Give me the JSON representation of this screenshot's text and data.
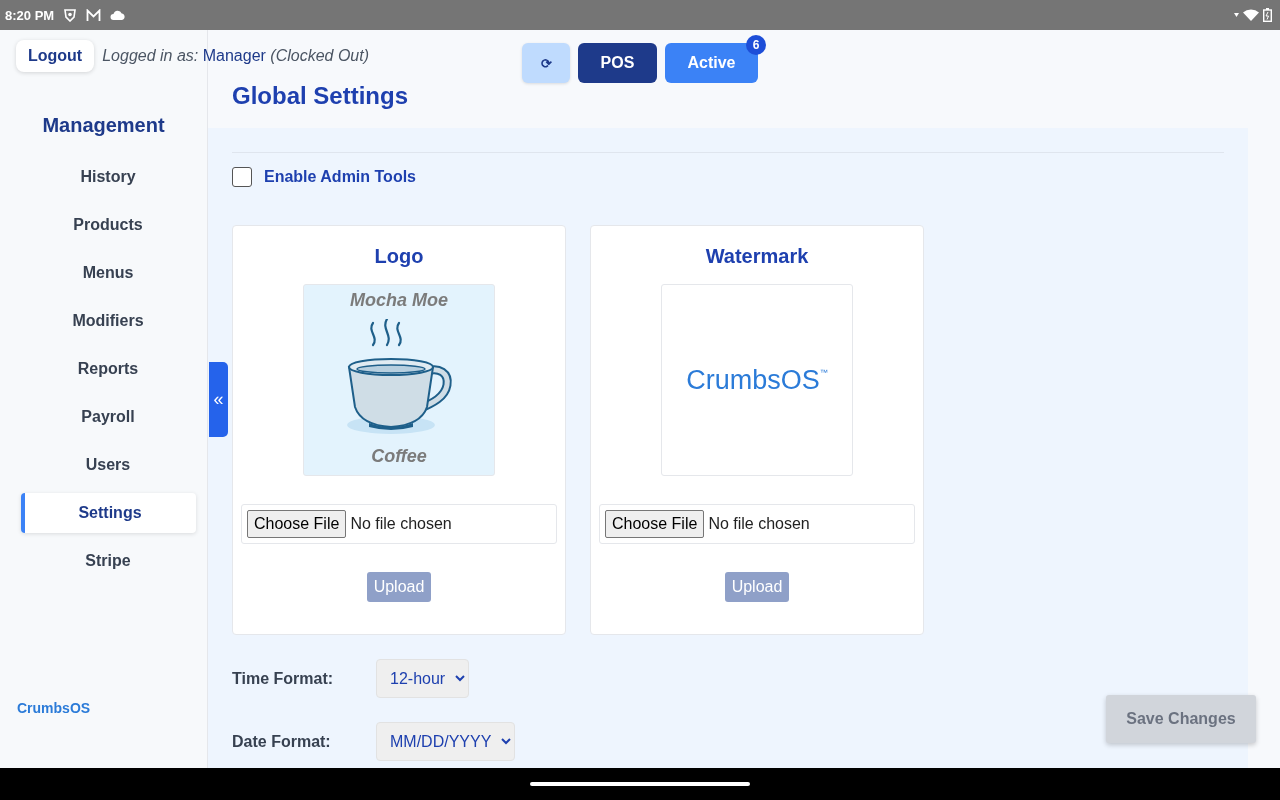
{
  "status_bar": {
    "time": "8:20 PM"
  },
  "header": {
    "logout": "Logout",
    "logged_in_label": "Logged in as:",
    "user": "Manager",
    "clock_status": "(Clocked Out)",
    "refresh": "⟳",
    "pos": "POS",
    "active": "Active",
    "active_badge": "6"
  },
  "sidebar": {
    "title": "Management",
    "items": [
      {
        "label": "History",
        "selected": false
      },
      {
        "label": "Products",
        "selected": false
      },
      {
        "label": "Menus",
        "selected": false
      },
      {
        "label": "Modifiers",
        "selected": false
      },
      {
        "label": "Reports",
        "selected": false
      },
      {
        "label": "Payroll",
        "selected": false
      },
      {
        "label": "Users",
        "selected": false
      },
      {
        "label": "Settings",
        "selected": true
      },
      {
        "label": "Stripe",
        "selected": false
      }
    ],
    "collapse": "«",
    "brand": "CrumbsOS"
  },
  "page": {
    "title": "Global Settings",
    "admin_tools": {
      "label": "Enable Admin Tools",
      "checked": false
    },
    "uploads": [
      {
        "title": "Logo",
        "preview": {
          "kind": "cup",
          "top_text": "Mocha Moe",
          "bottom_text": "Coffee"
        },
        "choose": "Choose File",
        "file": "No file chosen",
        "upload": "Upload",
        "disabled": true
      },
      {
        "title": "Watermark",
        "preview": {
          "kind": "wordmark",
          "text": "CrumbsOS",
          "mark": "™"
        },
        "choose": "Choose File",
        "file": "No file chosen",
        "upload": "Upload",
        "disabled": true
      }
    ],
    "time_format": {
      "label": "Time Format:",
      "value": "12-hour"
    },
    "date_format": {
      "label": "Date Format:",
      "value": "MM/DD/YYYY"
    },
    "save": {
      "label": "Save Changes",
      "disabled": true
    }
  }
}
